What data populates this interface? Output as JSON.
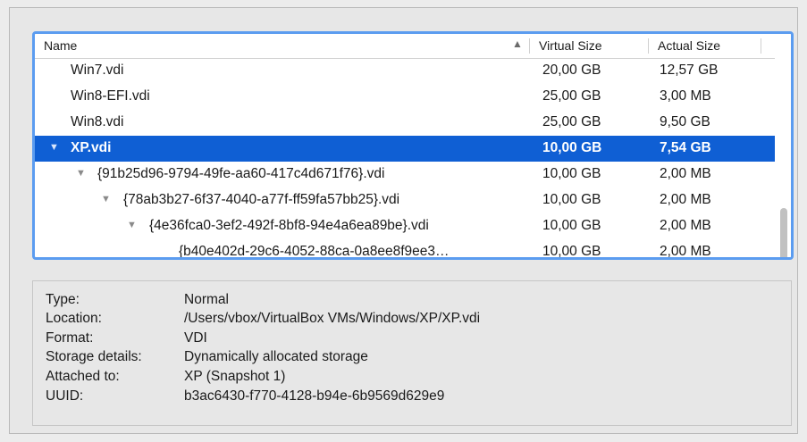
{
  "columns": {
    "name": "Name",
    "virtual_size": "Virtual Size",
    "actual_size": "Actual Size"
  },
  "rows": [
    {
      "name": "Win7.vdi",
      "virtual_size": "20,00 GB",
      "actual_size": "12,57 GB",
      "level": 0,
      "expanded": null,
      "selected": false
    },
    {
      "name": "Win8-EFI.vdi",
      "virtual_size": "25,00 GB",
      "actual_size": "3,00 MB",
      "level": 0,
      "expanded": null,
      "selected": false
    },
    {
      "name": "Win8.vdi",
      "virtual_size": "25,00 GB",
      "actual_size": "9,50 GB",
      "level": 0,
      "expanded": null,
      "selected": false
    },
    {
      "name": "XP.vdi",
      "virtual_size": "10,00 GB",
      "actual_size": "7,54 GB",
      "level": 0,
      "expanded": true,
      "selected": true
    },
    {
      "name": "{91b25d96-9794-49fe-aa60-417c4d671f76}.vdi",
      "virtual_size": "10,00 GB",
      "actual_size": "2,00 MB",
      "level": 1,
      "expanded": true,
      "selected": false
    },
    {
      "name": "{78ab3b27-6f37-4040-a77f-ff59fa57bb25}.vdi",
      "virtual_size": "10,00 GB",
      "actual_size": "2,00 MB",
      "level": 2,
      "expanded": true,
      "selected": false
    },
    {
      "name": "{4e36fca0-3ef2-492f-8bf8-94e4a6ea89be}.vdi",
      "virtual_size": "10,00 GB",
      "actual_size": "2,00 MB",
      "level": 3,
      "expanded": true,
      "selected": false
    },
    {
      "name": "{b40e402d-29c6-4052-88ca-0a8ee8f9ee3…",
      "virtual_size": "10,00 GB",
      "actual_size": "2,00 MB",
      "level": 4,
      "expanded": null,
      "selected": false
    }
  ],
  "details": {
    "type": {
      "label": "Type:",
      "value": "Normal"
    },
    "location": {
      "label": "Location:",
      "value": "/Users/vbox/VirtualBox VMs/Windows/XP/XP.vdi"
    },
    "format": {
      "label": "Format:",
      "value": "VDI"
    },
    "storage": {
      "label": "Storage details:",
      "value": "Dynamically allocated storage"
    },
    "attached": {
      "label": "Attached to:",
      "value": "XP (Snapshot 1)"
    },
    "uuid": {
      "label": "UUID:",
      "value": "b3ac6430-f770-4128-b94e-6b9569d629e9"
    }
  },
  "icons": {
    "sort": "sort-ascending-icon",
    "disclosure": "disclosure-triangle-icon"
  },
  "colors": {
    "selection": "#0f5fd4",
    "focus_ring": "#5b9cf0"
  }
}
